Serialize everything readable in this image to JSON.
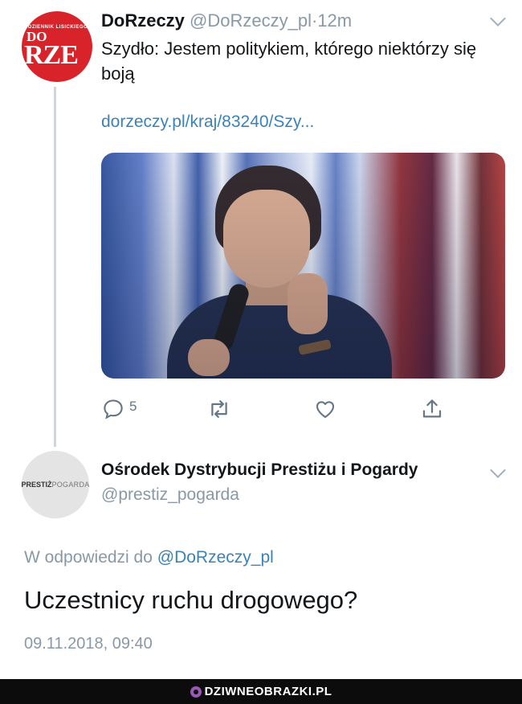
{
  "tweet1": {
    "avatar_logo_small": "DZIENNIK LISICKIEGO",
    "avatar_logo_do": "DO",
    "avatar_logo_rze": "RZE",
    "name": "DoRzeczy",
    "handle": "@DoRzeczy_pl",
    "dot": "·",
    "time": "12m",
    "text": "Szydło: Jestem politykiem, którego niektórzy się boją",
    "link": "dorzeczy.pl/kraj/83240/Szy...",
    "reply_count": "5",
    "icons": {
      "reply": "comment-icon",
      "retweet": "retweet-icon",
      "like": "heart-icon",
      "share": "share-icon",
      "more": "chevron-down-icon"
    }
  },
  "tweet2": {
    "avatar_logo_bold": "PRESTIŻ",
    "avatar_logo_light": "POGARDA",
    "name": "Ośrodek Dystrybucji Prestiżu i Pogardy",
    "handle": "@prestiz_pogarda",
    "reply_prefix": "W odpowiedzi do",
    "reply_mention": "@DoRzeczy_pl",
    "text": "Uczestnicy ruchu drogowego?",
    "date": "09.11.2018, 09:40"
  },
  "footer": {
    "watermark": "DZIWNEOBRAZKI.PL"
  },
  "colors": {
    "link": "#3b82b8",
    "muted": "#8899a6",
    "text": "#14171a",
    "brand_red": "#d8232a",
    "footer_bg": "#0c0c0c"
  }
}
